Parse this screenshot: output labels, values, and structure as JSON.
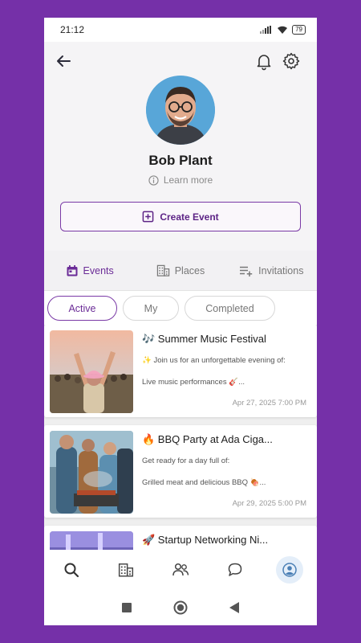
{
  "status": {
    "time": "21:12",
    "battery": "79"
  },
  "profile": {
    "name": "Bob Plant",
    "learn_more": "Learn more"
  },
  "create_event_label": "Create Event",
  "tabs": [
    {
      "label": "Events",
      "icon": "calendar-icon",
      "active": true
    },
    {
      "label": "Places",
      "icon": "building-icon",
      "active": false
    },
    {
      "label": "Invitations",
      "icon": "playlist-add-icon",
      "active": false
    }
  ],
  "filters": [
    {
      "label": "Active",
      "active": true
    },
    {
      "label": "My",
      "active": false
    },
    {
      "label": "Completed",
      "active": false
    }
  ],
  "events": [
    {
      "title": "🎶 Summer Music Festival",
      "desc": "✨ Join us for an unforgettable evening of:",
      "line": "Live music performances 🎸...",
      "date": "Apr 27, 2025 7:00 PM"
    },
    {
      "title": "🔥 BBQ Party at Ada Ciga...",
      "desc": "Get ready for a day full of:",
      "line": "Grilled meat and delicious BBQ 🍖...",
      "date": "Apr 29, 2025 5:00 PM"
    },
    {
      "title": "🚀 Startup Networking Ni...",
      "desc": "",
      "line": "",
      "date": ""
    }
  ],
  "bottom_nav": [
    "search-icon",
    "building-icon",
    "people-icon",
    "chat-icon",
    "profile-icon"
  ],
  "colors": {
    "background": "#7530a8",
    "accent": "#6b2c97",
    "header_bg": "#f5f4f6"
  }
}
